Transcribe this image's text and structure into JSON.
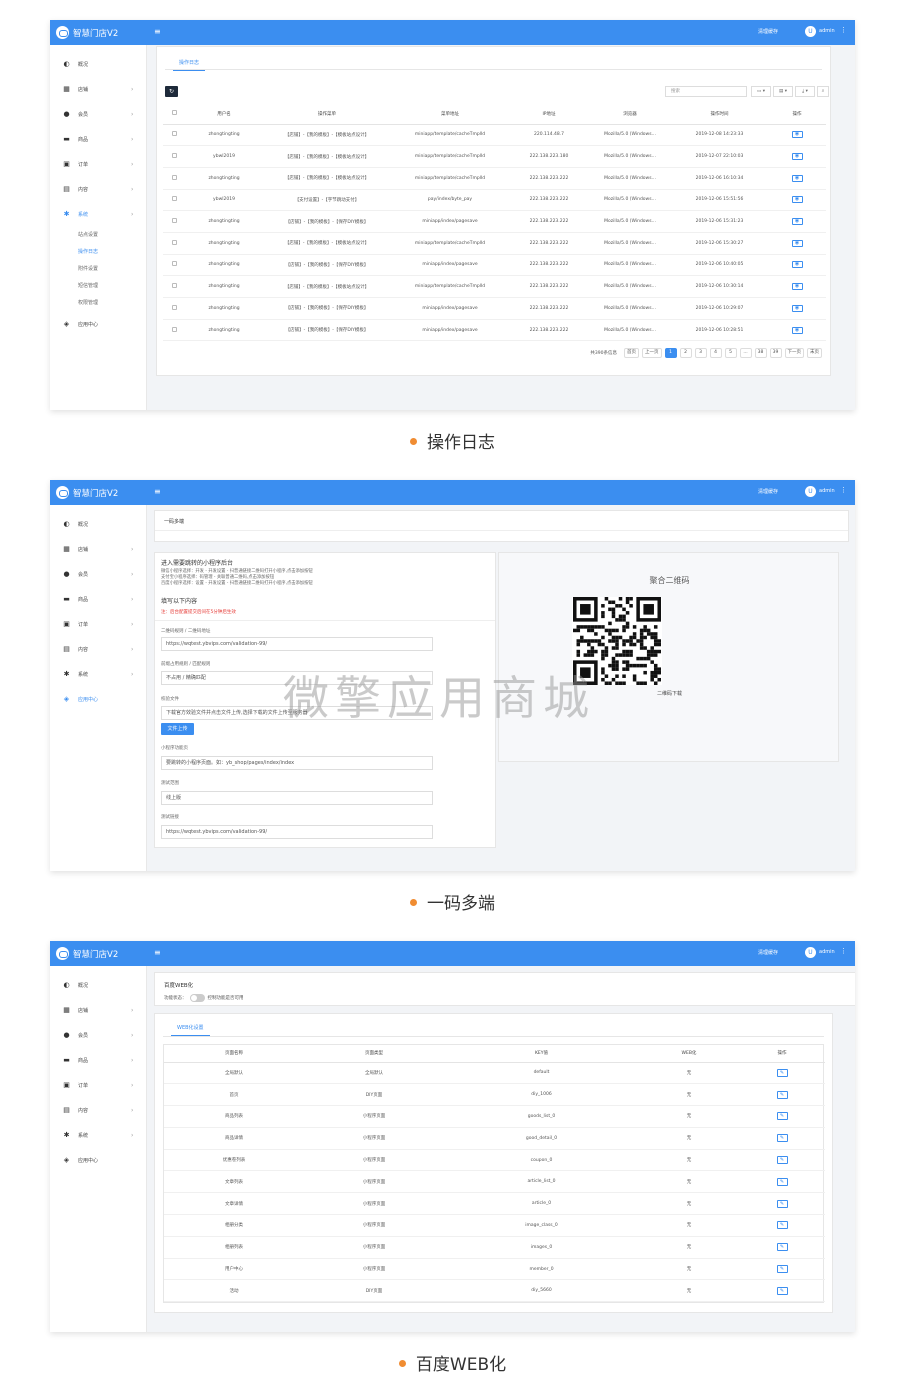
{
  "common": {
    "app_title": "智慧门店V2",
    "menu_icon": "≡",
    "clear_cache": "清理缓存",
    "admin_initial": "U",
    "admin_name": "admin",
    "more": "⋮",
    "chev": "›"
  },
  "sidebar_main": [
    {
      "label": "概况",
      "icon": "dashboard-icon",
      "glyph": "◐"
    },
    {
      "label": "店铺",
      "icon": "grid-icon",
      "glyph": "▦"
    },
    {
      "label": "会员",
      "icon": "users-icon",
      "glyph": "●"
    },
    {
      "label": "商品",
      "icon": "cart-icon",
      "glyph": "▬"
    },
    {
      "label": "订单",
      "icon": "order-icon",
      "glyph": "▣"
    },
    {
      "label": "内容",
      "icon": "file-icon",
      "glyph": "▤"
    },
    {
      "label": "系统",
      "icon": "gear-icon",
      "glyph": "✱"
    },
    {
      "label": "应用中心",
      "icon": "cube-icon",
      "glyph": "◈"
    }
  ],
  "panel1": {
    "tab": "操作日志",
    "refresh": "↻",
    "search_placeholder": "搜索",
    "tool_labels": [
      "▭ ▾",
      "▤ ▾",
      "⤓ ▾",
      "⌕"
    ],
    "sub_items": [
      "站点设置",
      "操作日志",
      "附件设置",
      "短信管理",
      "权限管理"
    ],
    "headers": [
      "用户名",
      "操作菜单",
      "菜单地址",
      "IP地址",
      "浏览器",
      "操作时间",
      "操作"
    ],
    "rows": [
      [
        "zhongtingting",
        "【店铺】-【我的模板】-【模板站点设计】",
        "miniapp/template/cacheTmplId",
        "220.114.48.7",
        "Mozilla/5.0 (Windows...",
        "2019-12-08 14:23:33"
      ],
      [
        "ybwl2019",
        "【店铺】-【我的模板】-【模板站点设计】",
        "miniapp/template/cacheTmplId",
        "222.138.223.180",
        "Mozilla/5.0 (Windows...",
        "2019-12-07 22:10:03"
      ],
      [
        "zhongtingting",
        "【店铺】-【我的模板】-【模板站点设计】",
        "miniapp/template/cacheTmplId",
        "222.138.223.222",
        "Mozilla/5.0 (Windows...",
        "2019-12-06 16:10:34"
      ],
      [
        "ybwl2019",
        "【支付设置】-【字节跳动支付】",
        "pay/index/byte_pay",
        "222.138.223.222",
        "Mozilla/5.0 (Windows...",
        "2019-12-06 15:51:56"
      ],
      [
        "zhongtingting",
        "【店铺】-【我的模板】-【保存DIY模板】",
        "miniapp/index/pagesave",
        "222.138.223.222",
        "Mozilla/5.0 (Windows...",
        "2019-12-06 15:31:23"
      ],
      [
        "zhongtingting",
        "【店铺】-【我的模板】-【模板站点设计】",
        "miniapp/template/cacheTmplId",
        "222.138.223.222",
        "Mozilla/5.0 (Windows...",
        "2019-12-06 15:30:27"
      ],
      [
        "zhongtingting",
        "【店铺】-【我的模板】-【保存DIY模板】",
        "miniapp/index/pagesave",
        "222.138.223.222",
        "Mozilla/5.0 (Windows...",
        "2019-12-06 10:40:05"
      ],
      [
        "zhongtingting",
        "【店铺】-【我的模板】-【模板站点设计】",
        "miniapp/template/cacheTmplId",
        "222.138.223.222",
        "Mozilla/5.0 (Windows...",
        "2019-12-06 10:30:14"
      ],
      [
        "zhongtingting",
        "【店铺】-【我的模板】-【保存DIY模板】",
        "miniapp/index/pagesave",
        "222.138.223.222",
        "Mozilla/5.0 (Windows...",
        "2019-12-06 10:29:07"
      ],
      [
        "zhongtingting",
        "【店铺】-【我的模板】-【保存DIY模板】",
        "miniapp/index/pagesave",
        "222.138.223.222",
        "Mozilla/5.0 (Windows...",
        "2019-12-06 10:28:51"
      ]
    ],
    "pager": {
      "total": "共390条信息",
      "first": "首页",
      "prev": "上一页",
      "pages": [
        "1",
        "2",
        "3",
        "4",
        "5",
        "...",
        "38",
        "39"
      ],
      "next": "下一页",
      "last": "末页"
    },
    "caption": "操作日志"
  },
  "panel2": {
    "title": "一码多端",
    "heading": "进入需要跳转的小程序后台",
    "lines": [
      "微信小程序选择：开发 - 开发设置 - 扫普通链接二维码打开小程序,点击添加按钮",
      "支付宝小程序选择：码管理 - 关联普通二维码,点击添加按钮",
      "百度小程序选择：设置 - 开发设置 - 扫普通链接二维码打开小程序,点击添加按钮"
    ],
    "fill": "填写以下内容",
    "note": "注：后台配置提交后间在5分钟后生效",
    "f1_label": "二维码规则 / 二维码地址",
    "f1_value": "https://wqtest.ybvips.com/validation-99/",
    "f2_label": "前缀占用规则 / 匹配规则",
    "f2_value": "不占用 / 精确匹配",
    "f3_label": "校验文件",
    "f3_value": "下载官方效验文件并点击文件上传,选择下载的文件上传至服务器",
    "upload": "文件上传",
    "f4_label": "小程序功能页",
    "f4_value": "要跳转的小程序页面。如：yb_shop/pages/index/index",
    "f5_label": "测试范围",
    "f5_value": "线上版",
    "f6_label": "测试链接",
    "f6_value": "https://wqtest.ybvips.com/validation-99/",
    "qr_title": "聚合二维码",
    "qr_download": "二维码下载",
    "watermark": "微擎应用商城",
    "caption": "一码多端"
  },
  "panel3": {
    "title": "百度WEB化",
    "status_label": "功能状态：",
    "status_hint": "控制功能是否可用",
    "tab": "WEB化设置",
    "headers": [
      "页面名称",
      "页面类型",
      "KEY值",
      "WEB化",
      "操作"
    ],
    "rows": [
      [
        "全局默认",
        "全局默认",
        "default",
        "无"
      ],
      [
        "首页",
        "DIY页面",
        "diy_1006",
        "无"
      ],
      [
        "商品列表",
        "小程序页面",
        "goods_list_0",
        "无"
      ],
      [
        "商品详情",
        "小程序页面",
        "good_detail_0",
        "无"
      ],
      [
        "优惠卷列表",
        "小程序页面",
        "coupon_0",
        "无"
      ],
      [
        "文章列表",
        "小程序页面",
        "article_list_0",
        "无"
      ],
      [
        "文章详情",
        "小程序页面",
        "article_0",
        "无"
      ],
      [
        "相册分类",
        "小程序页面",
        "image_class_0",
        "无"
      ],
      [
        "相册列表",
        "小程序页面",
        "images_0",
        "无"
      ],
      [
        "用户中心",
        "小程序页面",
        "member_0",
        "无"
      ],
      [
        "活动",
        "DIY页面",
        "diy_5660",
        "无"
      ]
    ],
    "caption": "百度WEB化"
  },
  "colors": {
    "primary": "#3b8ef0",
    "accent_dot": "#f08c32",
    "danger": "#e53935"
  }
}
